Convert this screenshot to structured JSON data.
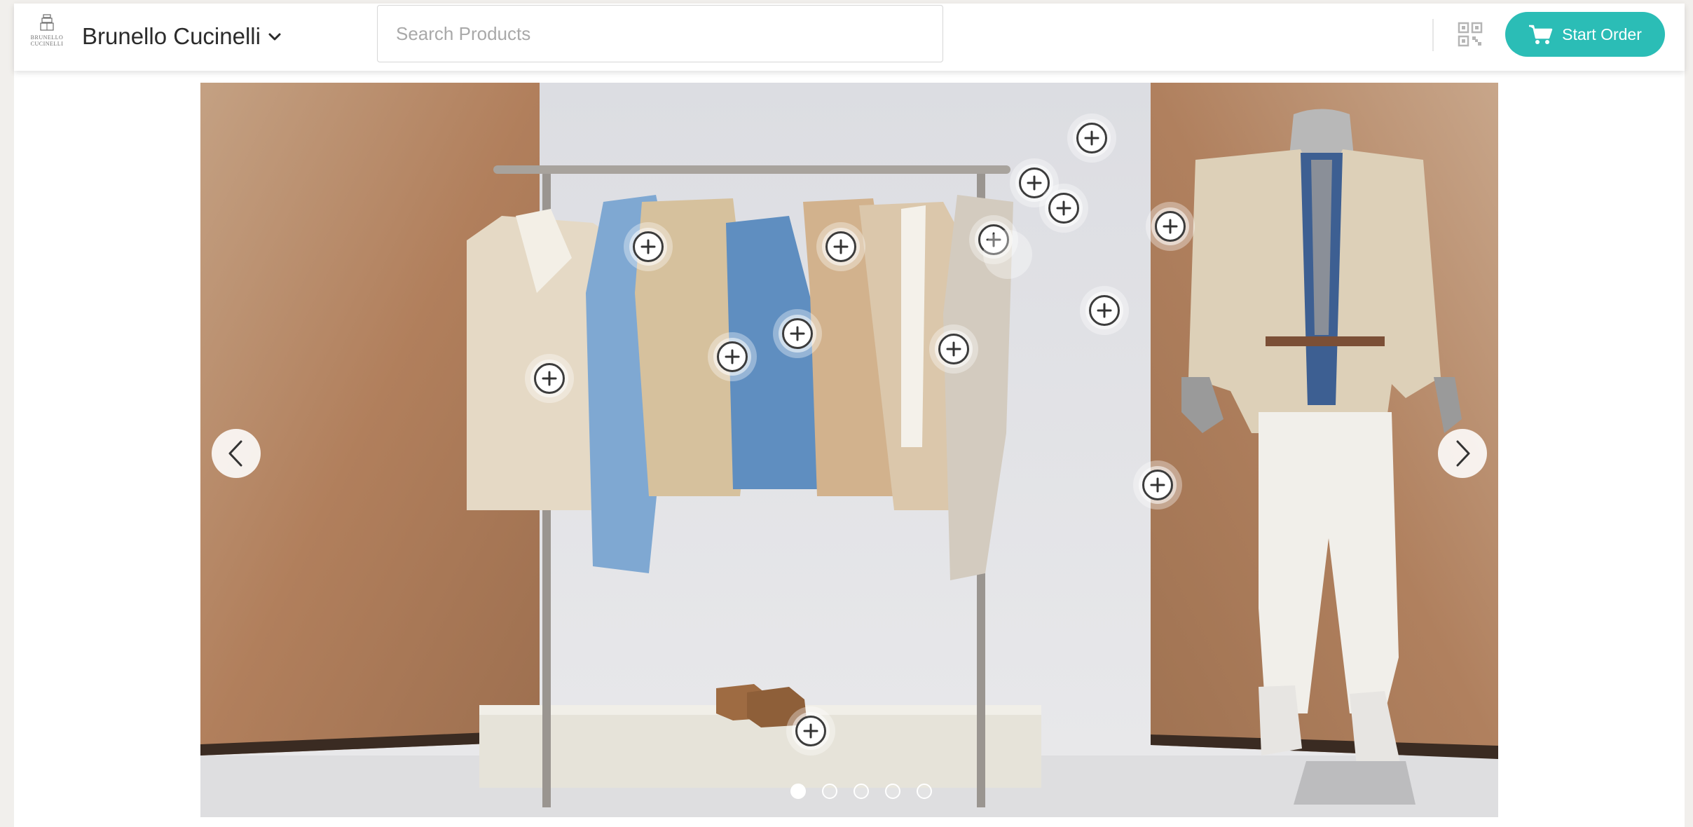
{
  "header": {
    "logo": {
      "icon": "brand-crest-icon",
      "wordmark_line1": "BRUNELLO",
      "wordmark_line2": "CUCINELLI"
    },
    "brand_name": "Brunello Cucinelli",
    "brand_dropdown_icon": "chevron-down-icon",
    "search": {
      "placeholder": "Search Products",
      "value": ""
    },
    "scan_icon": "qr-code-icon",
    "start_order": {
      "label": "Start Order",
      "icon": "cart-icon"
    }
  },
  "hero": {
    "prev_icon": "chevron-left-icon",
    "next_icon": "chevron-right-icon",
    "hotspot_icon": "plus-icon",
    "hotspot_count": 14,
    "slides_total": 5,
    "active_slide": 1
  },
  "colors": {
    "accent": "#2bbdb6",
    "text_primary": "#2b2b2b",
    "placeholder": "#a9a9a9",
    "page_background": "#f1efec"
  }
}
